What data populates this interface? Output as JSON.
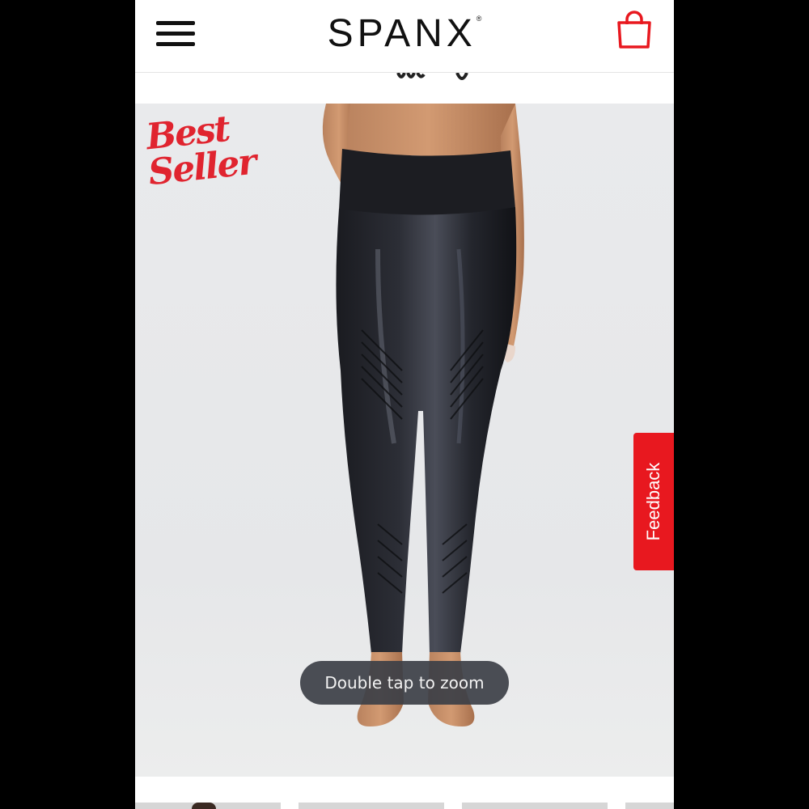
{
  "header": {
    "logo_text": "SPANX",
    "logo_mark": "®",
    "menu_icon": "hamburger-menu-icon",
    "cart_icon": "shopping-bag-icon",
    "brand_color": "#e8181f"
  },
  "product": {
    "badge_line1": "Best",
    "badge_line2": "Seller",
    "badge_color": "#e0242f"
  },
  "feedback": {
    "label": "Feedback"
  },
  "zoom_hint": {
    "label": "Double tap to zoom"
  },
  "thumbnails": {
    "count": 4
  }
}
